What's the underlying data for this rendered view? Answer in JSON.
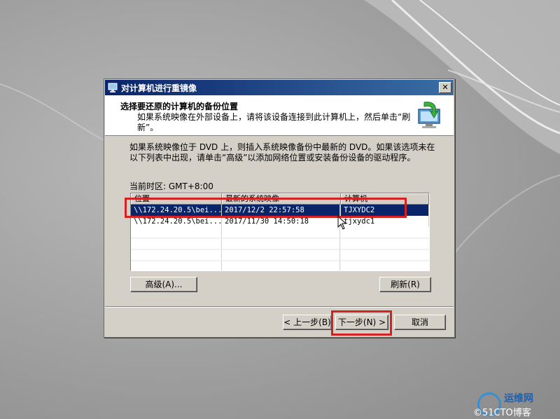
{
  "window": {
    "title": "对计算机进行重镜像",
    "close_glyph": "✕"
  },
  "header": {
    "title": "选择要还原的计算机的备份位置",
    "description": "如果系统映像在外部设备上，请将该设备连接到此计算机上，然后单击“刷新”。"
  },
  "intro_text": "如果系统映像位于 DVD 上，则插入系统映像备份中最新的 DVD。如果该选项未在以下列表中出现，请单击“高级”以添加网络位置或安装备份设备的驱动程序。",
  "timezone_label": "当前时区: GMT+8:00",
  "table": {
    "columns": [
      "位置",
      "最新的系统映像",
      "计算机"
    ],
    "rows": [
      {
        "location": "\\\\172.24.20.5\\bei...",
        "latest": "2017/12/2 22:57:58",
        "computer": "TJXYDC2",
        "selected": true
      },
      {
        "location": "\\\\172.24.20.5\\bei...",
        "latest": "2017/11/30 14:50:18",
        "computer": "tjxydc1",
        "selected": false
      }
    ]
  },
  "buttons": {
    "advanced": "高级(A)...",
    "refresh": "刷新(R)",
    "back": "< 上一步(B)",
    "next": "下一步(N) >",
    "cancel": "取消"
  },
  "watermark": {
    "brand": "运维网",
    "site": "©51CTO博客"
  },
  "colors": {
    "selection": "#0a246a",
    "highlight_box": "#d42222",
    "title_bar": "#0a246a"
  }
}
